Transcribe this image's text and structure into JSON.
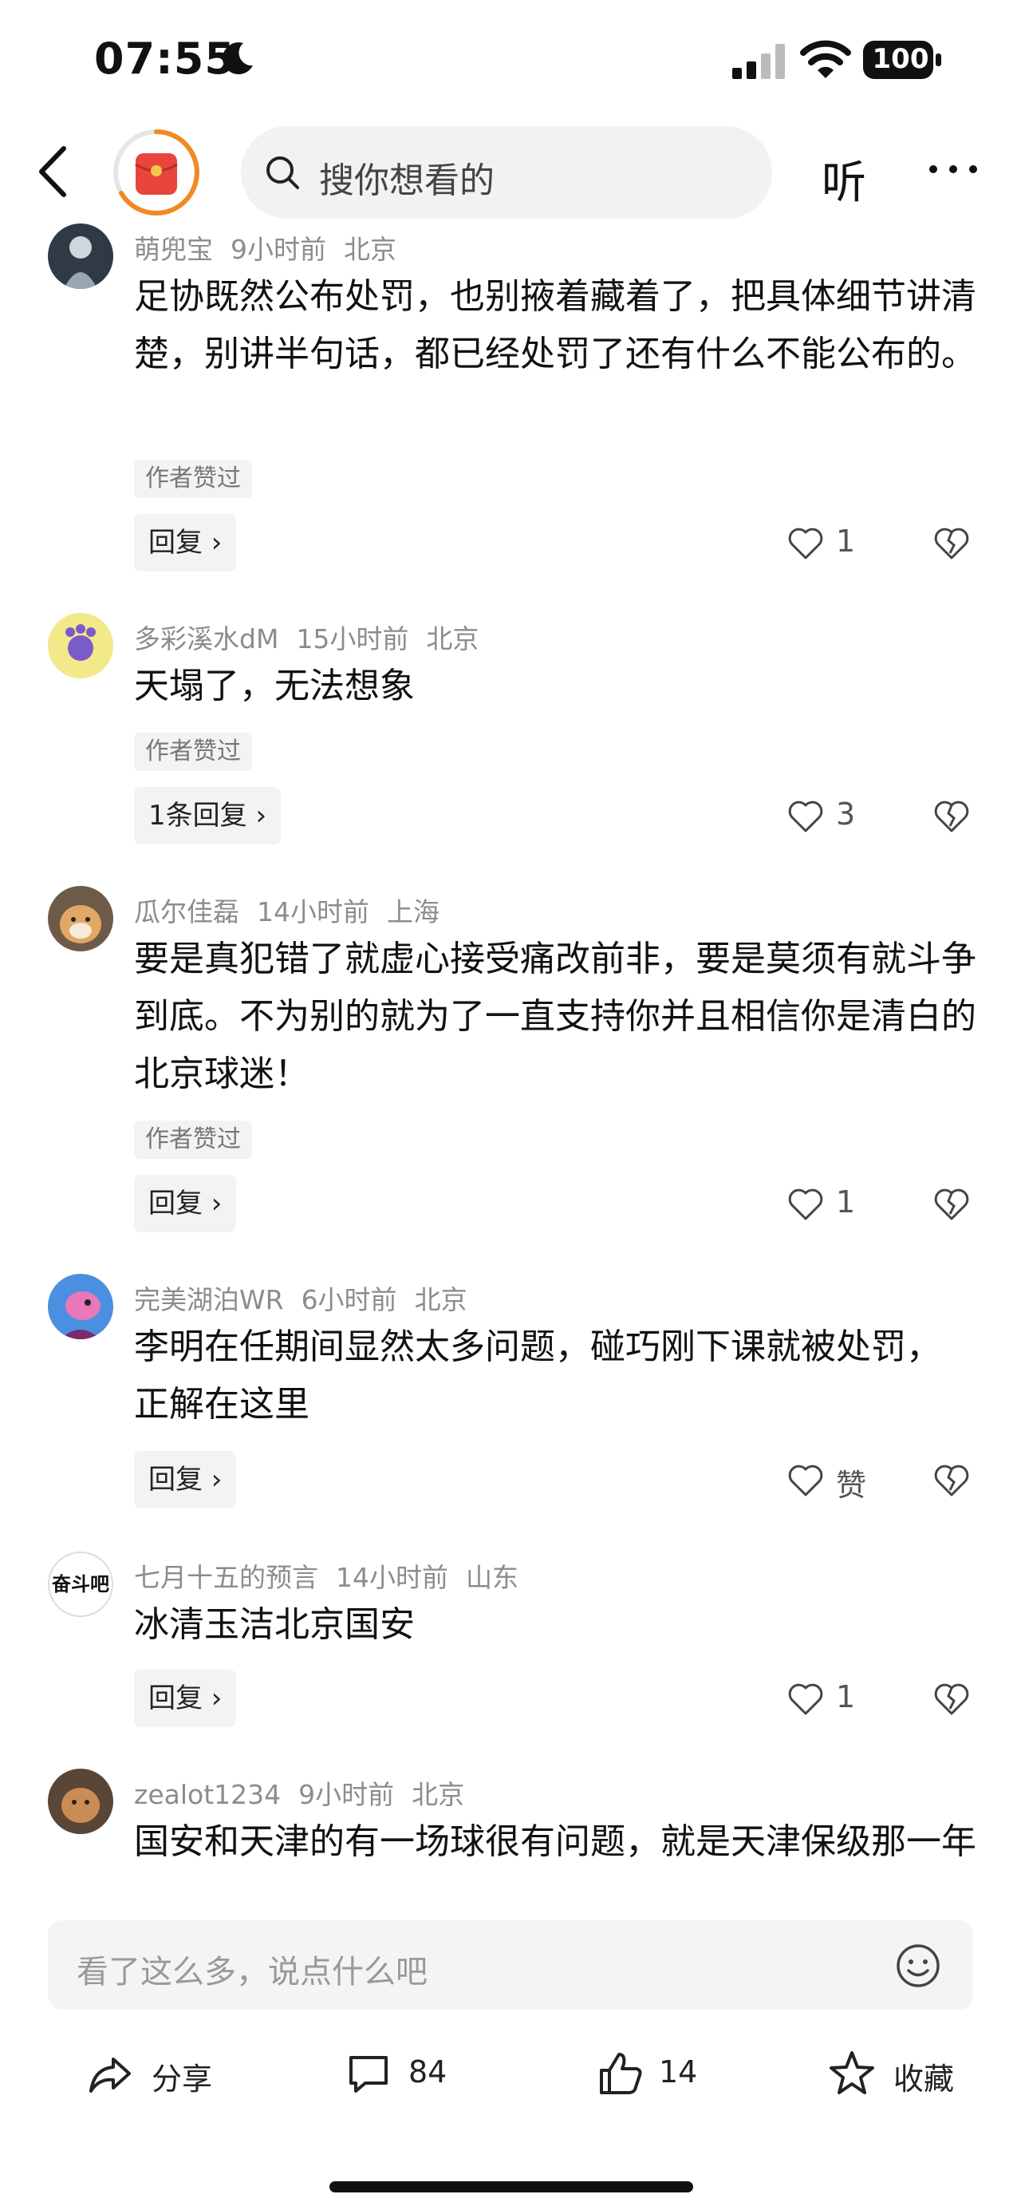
{
  "status_bar": {
    "time": "07:55",
    "battery": "100"
  },
  "top_nav": {
    "search_placeholder": "搜你想看的",
    "listen_label": "听"
  },
  "comments": [
    {
      "user": "萌兜宝",
      "time": "9小时前",
      "location": "北京",
      "text": "足协既然公布处罚，也别掖着藏着了，把具体细节讲清楚，别讲半句话，都已经处罚了还有什么不能公布的。",
      "tag": "作者赞过",
      "reply": "回复",
      "likes": "1"
    },
    {
      "user": "多彩溪水dM",
      "time": "15小时前",
      "location": "北京",
      "text": "天塌了，无法想象",
      "tag": "作者赞过",
      "reply": "1条回复",
      "likes": "3"
    },
    {
      "user": "瓜尔佳磊",
      "time": "14小时前",
      "location": "上海",
      "text": "要是真犯错了就虚心接受痛改前非，要是莫须有就斗争到底。不为别的就为了一直支持你并且相信你是清白的北京球迷！",
      "tag": "作者赞过",
      "reply": "回复",
      "likes": "1"
    },
    {
      "user": "完美湖泊WR",
      "time": "6小时前",
      "location": "北京",
      "text": "李明在任期间显然太多问题，碰巧刚下课就被处罚，正解在这里",
      "tag": "",
      "reply": "回复",
      "likes": "赞"
    },
    {
      "user": "七月十五的预言",
      "time": "14小时前",
      "location": "山东",
      "text": "冰清玉洁北京国安",
      "tag": "",
      "reply": "回复",
      "likes": "1"
    },
    {
      "user": "zealot1234",
      "time": "9小时前",
      "location": "北京",
      "text": "国安和天津的有一场球很有问题，就是天津保级那一年",
      "tag": "",
      "reply": "",
      "likes": ""
    }
  ],
  "input": {
    "placeholder": "看了这么多，说点什么吧"
  },
  "bottom_bar": {
    "share_label": "分享",
    "comment_count": "84",
    "like_count": "14",
    "favorite_label": "收藏"
  },
  "avatar_text": {
    "c5": "奋斗吧"
  },
  "icons": [
    "back-icon",
    "red-packet-icon",
    "search-icon",
    "more-icon",
    "heart-icon",
    "broken-heart-icon",
    "emoji-icon",
    "share-icon",
    "comment-icon",
    "thumbs-up-icon",
    "star-icon",
    "moon-icon",
    "signal-icon",
    "wifi-icon",
    "battery-icon"
  ],
  "colors": {
    "accent_orange": "#f08a24",
    "red_packet": "#e8453c",
    "meta_gray": "#8c8c8c",
    "chip_bg": "#f3f3f5"
  }
}
